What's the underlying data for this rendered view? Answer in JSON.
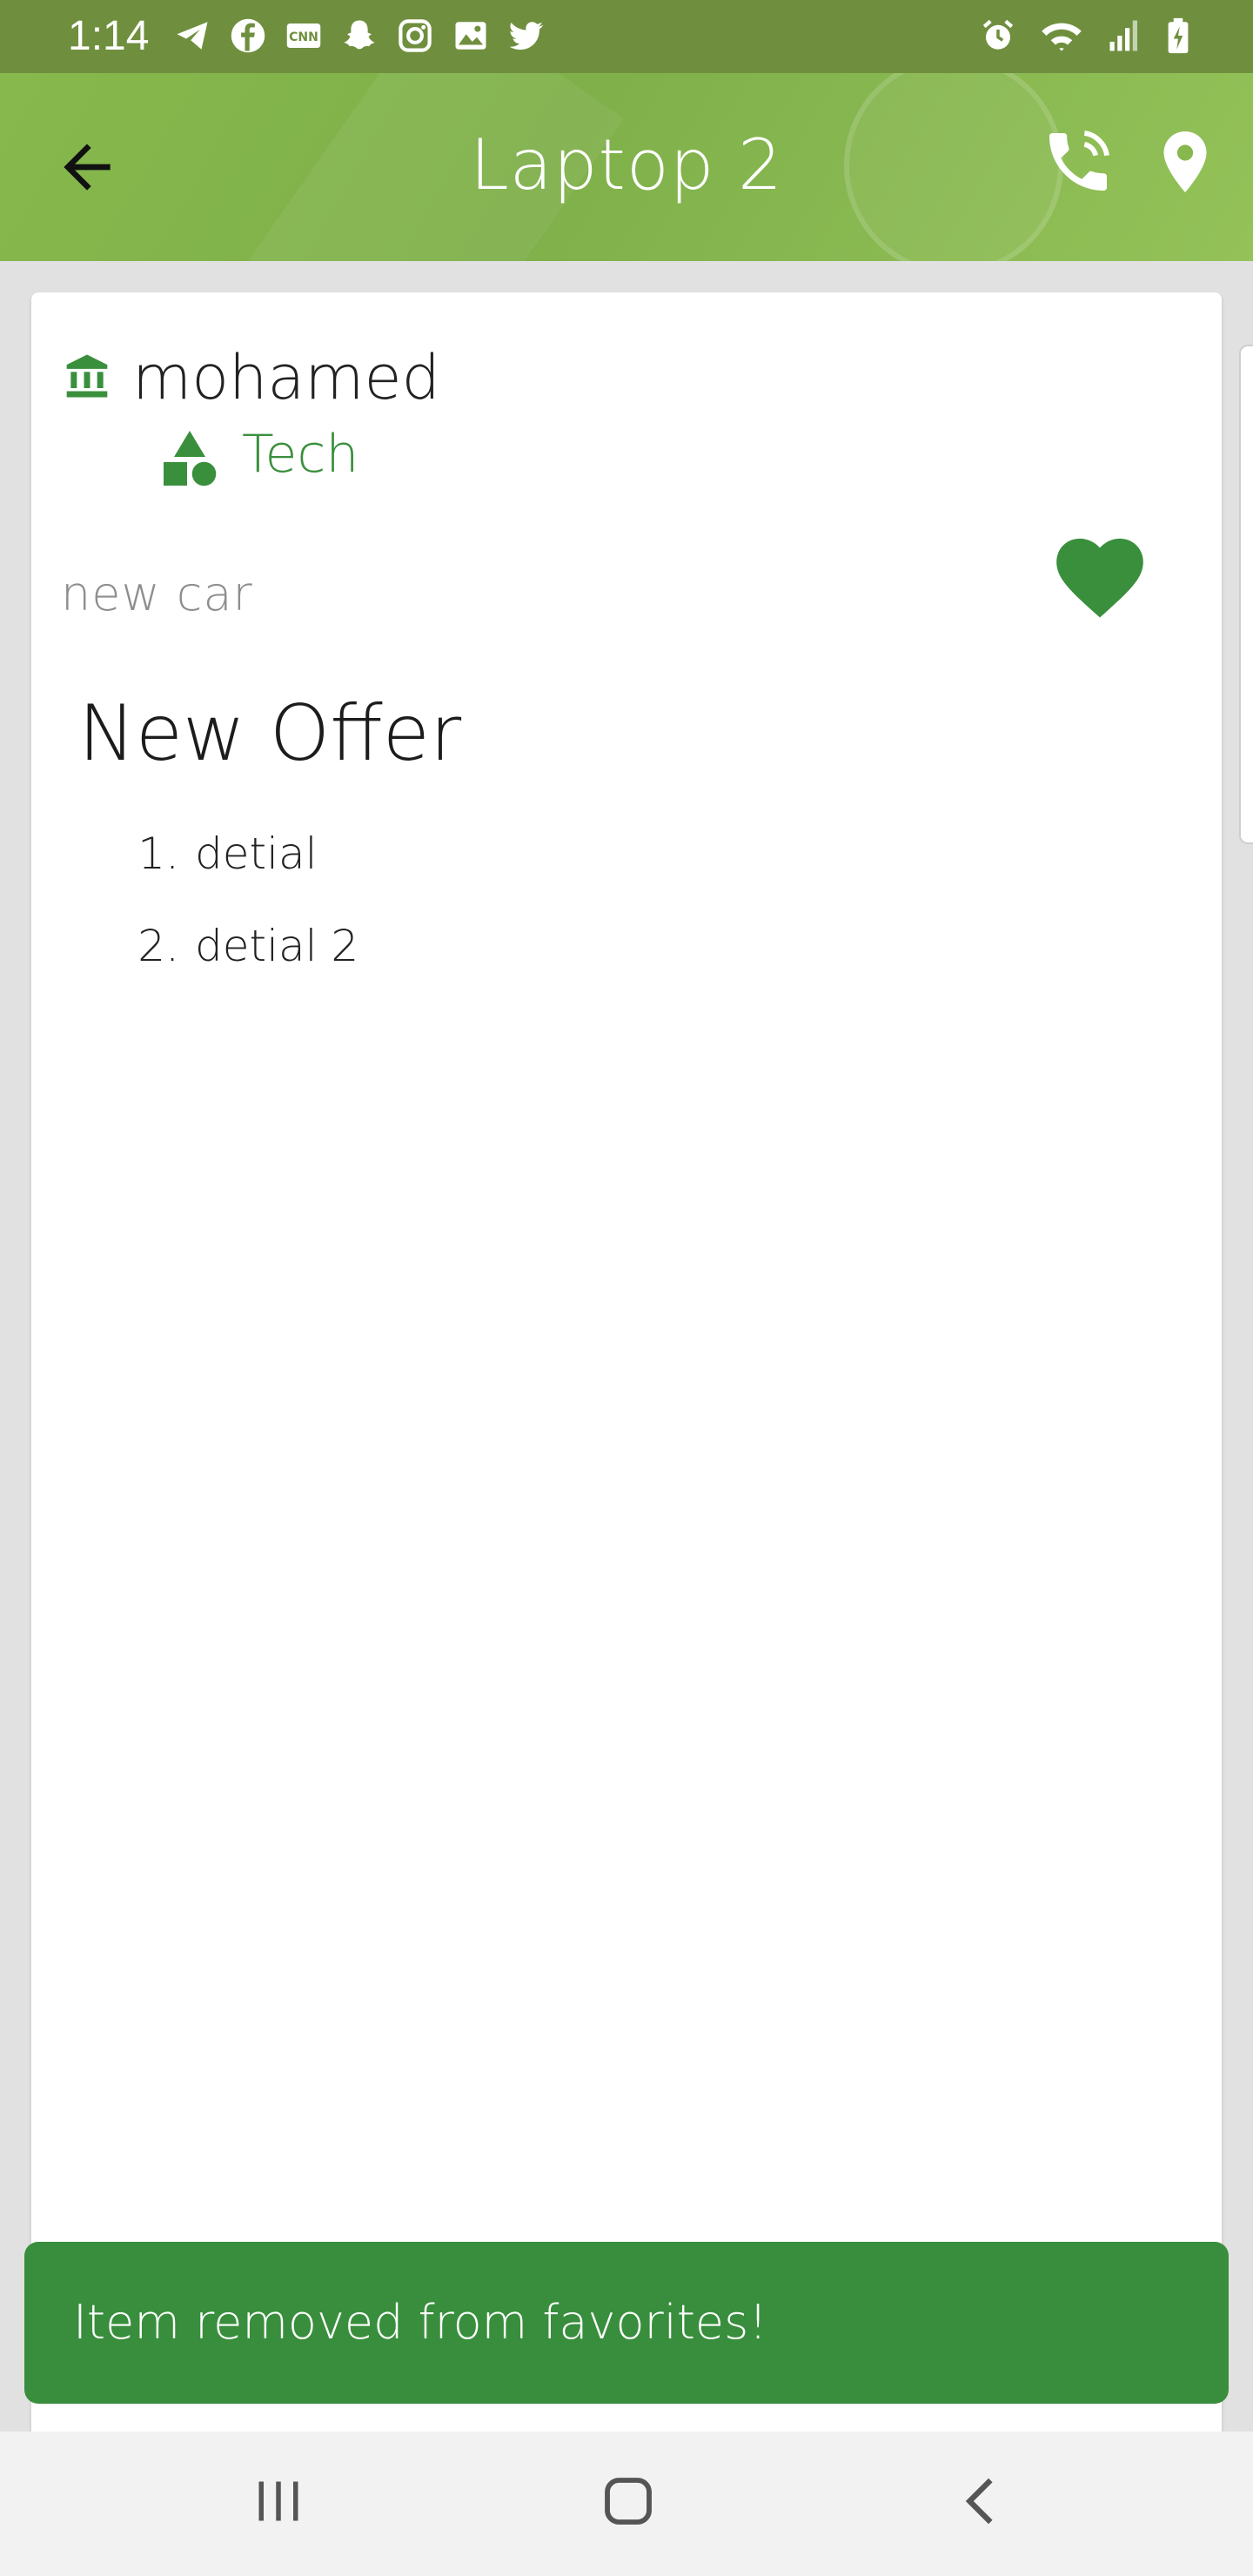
{
  "status_bar": {
    "time": "1:14",
    "left_icons": [
      "telegram-icon",
      "facebook-icon",
      "cnn-icon",
      "snapchat-icon",
      "instagram-icon",
      "gallery-icon",
      "twitter-icon"
    ],
    "right_icons": [
      "alarm-icon",
      "wifi-icon",
      "signal-icon",
      "battery-icon"
    ]
  },
  "app_bar": {
    "title": "Laptop 2",
    "back_icon": "arrow-back-icon",
    "call_icon": "phone-icon",
    "location_icon": "location-pin-icon",
    "color": "#86b84d"
  },
  "listing": {
    "author": "mohamed",
    "author_icon": "bank-icon",
    "category": "Tech",
    "category_icon": "shapes-icon",
    "subtitle": "new car",
    "favorite_icon": "heart-icon",
    "offer_title": "New Offer",
    "details": [
      {
        "num": "1.",
        "text": "detial"
      },
      {
        "num": "2.",
        "text": "detial 2"
      }
    ]
  },
  "snackbar": {
    "message": "Item removed from favorites!",
    "color": "#388e3c"
  },
  "nav_bar": {
    "recents_icon": "recents-icon",
    "home_icon": "home-icon",
    "back_icon": "back-icon"
  },
  "colors": {
    "accent": "#3a8f3d",
    "status_bar": "#6f8f3e"
  }
}
